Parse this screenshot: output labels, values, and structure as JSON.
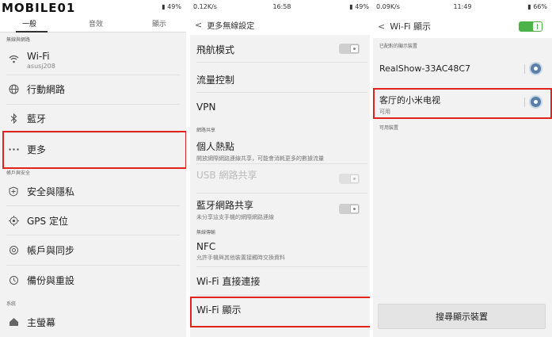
{
  "watermark": "MOBILE01",
  "panel1": {
    "status": {
      "battery": "49%"
    },
    "tabs": [
      "一般",
      "音效",
      "顯示"
    ],
    "sections": {
      "network": "無線與網路",
      "account": "帳戶與安全",
      "system": "系統"
    },
    "items": {
      "wifi": {
        "label": "Wi-Fi",
        "sub": "asusj208",
        "icon": "wifi-icon"
      },
      "mobile": {
        "label": "行動網路",
        "icon": "globe-icon"
      },
      "bluetooth": {
        "label": "藍牙",
        "icon": "bluetooth-icon"
      },
      "more": {
        "label": "更多",
        "icon": "more-icon"
      },
      "security": {
        "label": "安全與隱私",
        "icon": "shield-icon"
      },
      "gps": {
        "label": "GPS 定位",
        "icon": "location-icon"
      },
      "sync": {
        "label": "帳戶與同步",
        "icon": "sync-icon"
      },
      "backup": {
        "label": "備份與重設",
        "icon": "backup-icon"
      },
      "home": {
        "label": "主螢幕",
        "icon": "home-icon"
      }
    }
  },
  "panel2": {
    "status": {
      "speed": "0.12K/s",
      "time": "16:58",
      "battery": "49%"
    },
    "header": "更多無線設定",
    "section_tether": "網路共享",
    "section_transfer": "無線傳輸",
    "items": {
      "airplane": {
        "title": "飛航模式"
      },
      "traffic": {
        "title": "流量控制"
      },
      "vpn": {
        "title": "VPN"
      },
      "hotspot": {
        "title": "個人熱點",
        "desc": "開放網際網路連線共享，可能會消耗更多的數據流量"
      },
      "usb": {
        "title": "USB 網路共享",
        "desc": ""
      },
      "bt_tether": {
        "title": "藍牙網路共享",
        "desc": "未分享這支手機的網際網路連線"
      },
      "nfc": {
        "title": "NFC",
        "desc": "允許手機與其他裝置接觸時交換資料"
      },
      "wifi_direct": {
        "title": "Wi-Fi 直接連接"
      },
      "wifi_display": {
        "title": "Wi-Fi 顯示"
      }
    }
  },
  "panel3": {
    "status": {
      "speed": "0.09K/s",
      "time": "11:49",
      "battery": "66%"
    },
    "header": "Wi-Fi 顯示",
    "paired_label": "已配對的顯示裝置",
    "devices": [
      {
        "name": "RealShow-33AC48C7",
        "status": ""
      },
      {
        "name": "客厅的小米电视",
        "status": "可用"
      }
    ],
    "available_label": "可用裝置",
    "search_button": "搜尋顯示裝置"
  }
}
